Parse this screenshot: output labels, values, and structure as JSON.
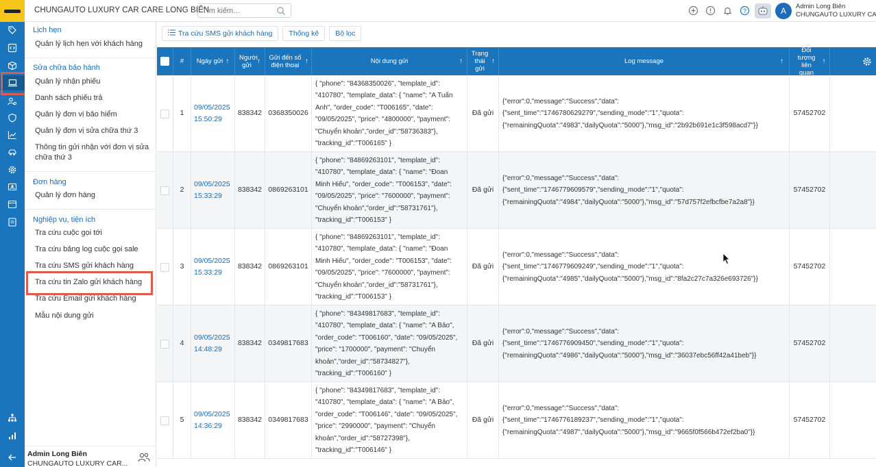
{
  "app": {
    "title": "CHUNGAUTO LUXURY CAR CARE LONG BIÊN"
  },
  "search": {
    "placeholder": "Tìm kiếm..."
  },
  "user": {
    "name": "Admin Long Biên",
    "company": "CHUNGAUTO LUXURY CAR CARE",
    "avatar": "A",
    "company_short": "CHUNGAUTO LUXURY CAR..."
  },
  "colors": {
    "brand": "#1b75bc",
    "highlight": "#e05a4e",
    "logo": "#f5c518"
  },
  "sidebar": {
    "sections": [
      {
        "title": "Lịch hẹn",
        "items": [
          "Quản lý lịch hẹn với khách hàng"
        ]
      },
      {
        "title": "Sửa chữa bảo hành",
        "items": [
          "Quản lý nhận phiếu",
          "Danh sách phiếu trả",
          "Quản lý đơn vị bảo hiểm",
          "Quản lý đơn vị sửa chữa thứ 3",
          "Thông tin gửi nhận với đơn vị sửa chữa thứ 3"
        ]
      },
      {
        "title": "Đơn hàng",
        "items": [
          "Quản lý đơn hàng"
        ]
      },
      {
        "title": "Nghiệp vụ, tiện ích",
        "items": [
          "Tra cứu cuộc gọi tới",
          "Tra cứu bảng log cuộc gọi sale",
          "Tra cứu SMS gửi khách hàng",
          "Tra cứu tin Zalo gửi khách hàng",
          "Tra cứu Email gửi khách hàng",
          "Mẫu nội dung gửi"
        ]
      }
    ]
  },
  "tabs": [
    {
      "label": "Tra cứu SMS gửi khách hàng",
      "icon": "list-icon"
    },
    {
      "label": "Thống kê"
    },
    {
      "label": "Bộ lọc"
    }
  ],
  "table": {
    "headers": {
      "index": "#",
      "date": "Ngày gửi",
      "sender": "Người gửi",
      "phone": "Gửi đến số điện thoại",
      "content": "Nội dung gửi",
      "status": "Trạng thái gửi",
      "log": "Log message",
      "related": "Đối tượng liên quan"
    },
    "rows": [
      {
        "index": "1",
        "date": "09/05/2025",
        "time": "15:50:29",
        "sender": "838342",
        "phone": "0368350026",
        "content": "{ \"phone\": \"84368350026\", \"template_id\":\n\"410780\", \"template_data\": { \"name\": \"A Tuấn\nAnh\", \"order_code\": \"T006165\", \"date\":\n\"09/05/2025\", \"price\": \"4800000\", \"payment\":\n\"Chuyển khoản\",\"order_id\":\"58736383\"},\n\"tracking_id\":\"T006165\" }",
        "status": "Đã gửi",
        "log": "{\"error\":0,\"message\":\"Success\",\"data\":\n{\"sent_time\":\"1746780629279\",\"sending_mode\":\"1\",\"quota\":\n{\"remainingQuota\":\"4983\",\"dailyQuota\":\"5000\"},\"msg_id\":\"2b92b691e1c3f598acd7\"}}",
        "related": "57452702"
      },
      {
        "index": "2",
        "date": "09/05/2025",
        "time": "15:33:29",
        "sender": "838342",
        "phone": "0869263101",
        "content": "{ \"phone\": \"84869263101\", \"template_id\":\n\"410780\", \"template_data\": { \"name\": \"Đoan\nMinh Hiếu\", \"order_code\": \"T006153\", \"date\":\n\"09/05/2025\", \"price\": \"7600000\", \"payment\":\n\"Chuyển khoản\",\"order_id\":\"58731761\"},\n\"tracking_id\":\"T006153\" }",
        "status": "Đã gửi",
        "log": "{\"error\":0,\"message\":\"Success\",\"data\":\n{\"sent_time\":\"1746779609579\",\"sending_mode\":\"1\",\"quota\":\n{\"remainingQuota\":\"4984\",\"dailyQuota\":\"5000\"},\"msg_id\":\"57d757f2efbcfbe7a2a8\"}}",
        "related": "57452702"
      },
      {
        "index": "3",
        "date": "09/05/2025",
        "time": "15:33:29",
        "sender": "838342",
        "phone": "0869263101",
        "content": "{ \"phone\": \"84869263101\", \"template_id\":\n\"410780\", \"template_data\": { \"name\": \"Đoan\nMinh Hiếu\", \"order_code\": \"T006153\", \"date\":\n\"09/05/2025\", \"price\": \"7600000\", \"payment\":\n\"Chuyển khoản\",\"order_id\":\"58731761\"},\n\"tracking_id\":\"T006153\" }",
        "status": "Đã gửi",
        "log": "{\"error\":0,\"message\":\"Success\",\"data\":\n{\"sent_time\":\"1746779609249\",\"sending_mode\":\"1\",\"quota\":\n{\"remainingQuota\":\"4985\",\"dailyQuota\":\"5000\"},\"msg_id\":\"8fa2c27c7a326e693726\"}}",
        "related": "57452702"
      },
      {
        "index": "4",
        "date": "09/05/2025",
        "time": "14:48:29",
        "sender": "838342",
        "phone": "0349817683",
        "content": "{ \"phone\": \"84349817683\", \"template_id\":\n\"410780\", \"template_data\": { \"name\": \"A Bảo\",\n\"order_code\": \"T006160\", \"date\": \"09/05/2025\",\n\"price\": \"1700000\", \"payment\": \"Chuyển\nkhoản\",\"order_id\":\"58734827\"},\n\"tracking_id\":\"T006160\" }",
        "status": "Đã gửi",
        "log": "{\"error\":0,\"message\":\"Success\",\"data\":\n{\"sent_time\":\"1746776909450\",\"sending_mode\":\"1\",\"quota\":\n{\"remainingQuota\":\"4986\",\"dailyQuota\":\"5000\"},\"msg_id\":\"36037ebc56ff42a41beb\"}}",
        "related": "57452702"
      },
      {
        "index": "5",
        "date": "09/05/2025",
        "time": "14:36:29",
        "sender": "838342",
        "phone": "0349817683",
        "content": "{ \"phone\": \"84349817683\", \"template_id\":\n\"410780\", \"template_data\": { \"name\": \"A Bảo\",\n\"order_code\": \"T006146\", \"date\": \"09/05/2025\",\n\"price\": \"2990000\", \"payment\": \"Chuyển\nkhoản\",\"order_id\":\"58727398\"},\n\"tracking_id\":\"T006146\" }",
        "status": "Đã gửi",
        "log": "{\"error\":0,\"message\":\"Success\",\"data\":\n{\"sent_time\":\"1746776189237\",\"sending_mode\":\"1\",\"quota\":\n{\"remainingQuota\":\"4987\",\"dailyQuota\":\"5000\"},\"msg_id\":\"9665f0f566b472ef2ba0\"}}",
        "related": "57452702"
      }
    ]
  }
}
